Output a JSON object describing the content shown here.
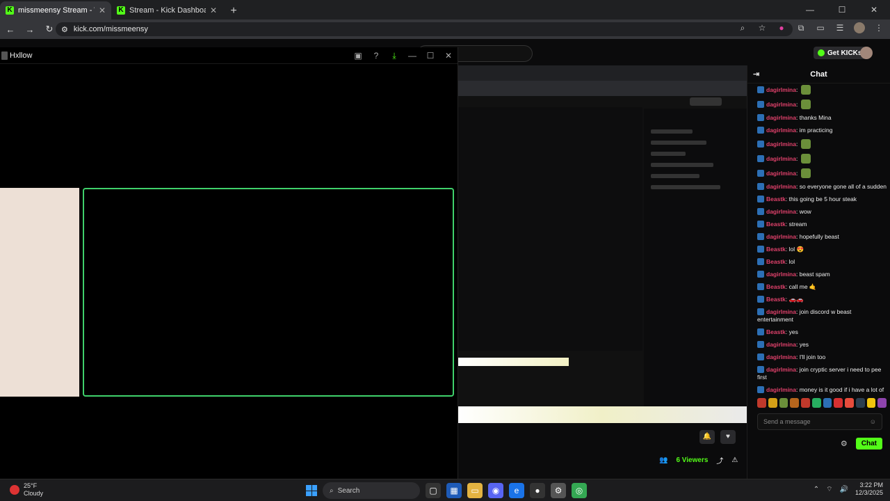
{
  "browser": {
    "tabs": [
      {
        "title": "missmeensy Stream - Watch Li"
      },
      {
        "title": "Stream - Kick Dashboard"
      }
    ],
    "url": "kick.com/missmeensy"
  },
  "header": {
    "get_kicks": "Get KICKs"
  },
  "app_window": {
    "title": "Hxllow"
  },
  "chat": {
    "title": "Chat",
    "messages": [
      {
        "user": "dagirlmina",
        "text": "",
        "emote": true
      },
      {
        "user": "dagirlmina",
        "text": "",
        "emote": true
      },
      {
        "user": "dagirlmina",
        "text": "thanks Mina"
      },
      {
        "user": "dagirlmina",
        "text": "im practicing"
      },
      {
        "user": "dagirlmina",
        "text": "",
        "emote": true
      },
      {
        "user": "dagirlmina",
        "text": "",
        "emote": true
      },
      {
        "user": "dagirlmina",
        "text": "",
        "emote": true
      },
      {
        "user": "dagirlmina",
        "text": "so everyone gone all of a sudden"
      },
      {
        "user": "Beastk",
        "text": "this going be 5 hour steak"
      },
      {
        "user": "dagirlmina",
        "text": "wow"
      },
      {
        "user": "Beastk",
        "text": "stream"
      },
      {
        "user": "dagirlmina",
        "text": "hopefully beast"
      },
      {
        "user": "Beastk",
        "text": "lol 😍"
      },
      {
        "user": "Beastk",
        "text": "lol"
      },
      {
        "user": "dagirlmina",
        "text": "beast spam"
      },
      {
        "user": "Beastk",
        "text": "call me 🤙"
      },
      {
        "user": "Beastk",
        "text": "🚗🚗"
      },
      {
        "user": "dagirlmina",
        "text": "join discord w beast entertainment"
      },
      {
        "user": "Beastk",
        "text": "yes"
      },
      {
        "user": "dagirlmina",
        "text": "yes"
      },
      {
        "user": "dagirlmina",
        "text": "I'll join too"
      },
      {
        "user": "dagirlmina",
        "text": "join cryptic server i need to pee first"
      },
      {
        "user": "dagirlmina",
        "text": "money is it good if i have a lot of interaction in chat on my first ever stream"
      }
    ],
    "input_placeholder": "Send a message",
    "send_label": "Chat",
    "emote_colors": [
      "#c0392b",
      "#d4a017",
      "#6b8f3a",
      "#b5651d",
      "#c0392b",
      "#27ae60",
      "#2c6fb5",
      "#d63031",
      "#e74c3c",
      "#2c3e50",
      "#f1c40f",
      "#8e44ad"
    ]
  },
  "stream": {
    "viewers": "6 Viewers"
  },
  "taskbar": {
    "weather_temp": "25°F",
    "weather_desc": "Cloudy",
    "search_label": "Search",
    "time": "3:22 PM",
    "date": "12/3/2025"
  },
  "colors": {
    "kick_green": "#53fc18",
    "frame_green": "#3fd16b"
  }
}
